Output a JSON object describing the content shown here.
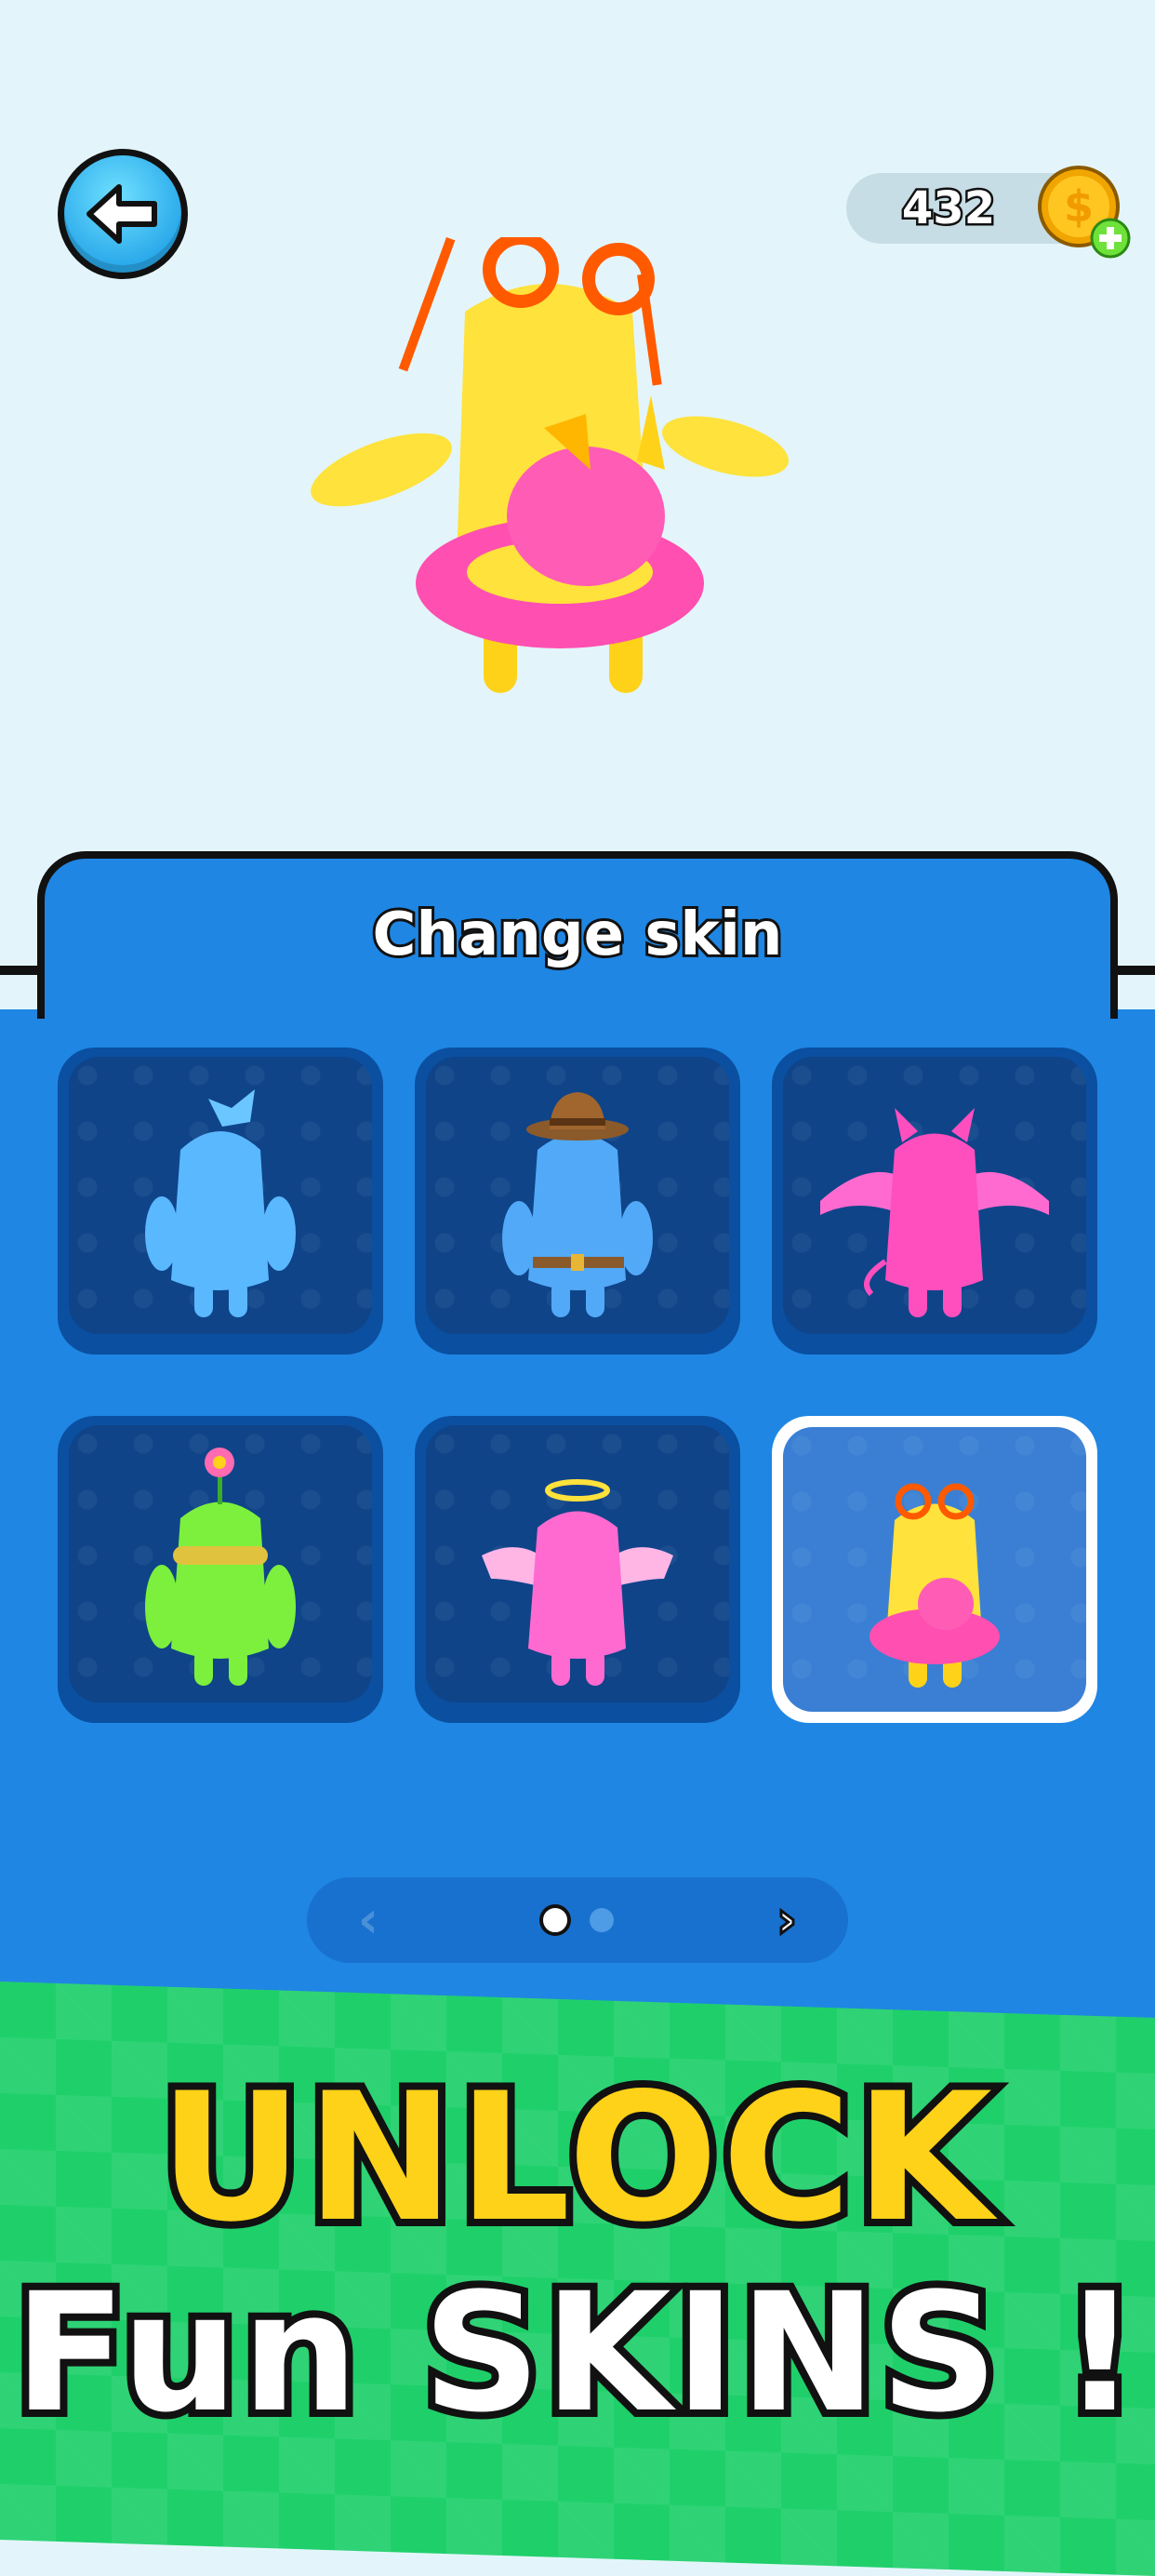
{
  "header": {
    "back_icon": "back-arrow-icon",
    "coins": "432",
    "coin_icon": "coin-plus-icon"
  },
  "panel": {
    "title": "Change skin"
  },
  "skins": [
    {
      "name": "blue-skin-with-bow",
      "color": "#5ab8ff",
      "selected": false
    },
    {
      "name": "blue-skin-with-cowboy-hat",
      "color": "#52a9f7",
      "selected": false
    },
    {
      "name": "pink-devil-skin",
      "color": "#ff5ec8",
      "selected": false
    },
    {
      "name": "green-skin-with-flower",
      "color": "#7cf03c",
      "selected": false
    },
    {
      "name": "pink-angel-skin",
      "color": "#ff6ad0",
      "selected": false
    },
    {
      "name": "yellow-skin-with-float",
      "color": "#ffe23b",
      "selected": true
    }
  ],
  "pager": {
    "prev": "‹",
    "next": "›",
    "pages": 2,
    "current": 1
  },
  "promo": {
    "line1": "UNLOCK",
    "line2": "Fun SKINS !"
  },
  "colors": {
    "panel": "#1f86e3",
    "tile": "#0f4489",
    "headline_yellow": "#ffd21a",
    "grass": "#1fd06a"
  }
}
